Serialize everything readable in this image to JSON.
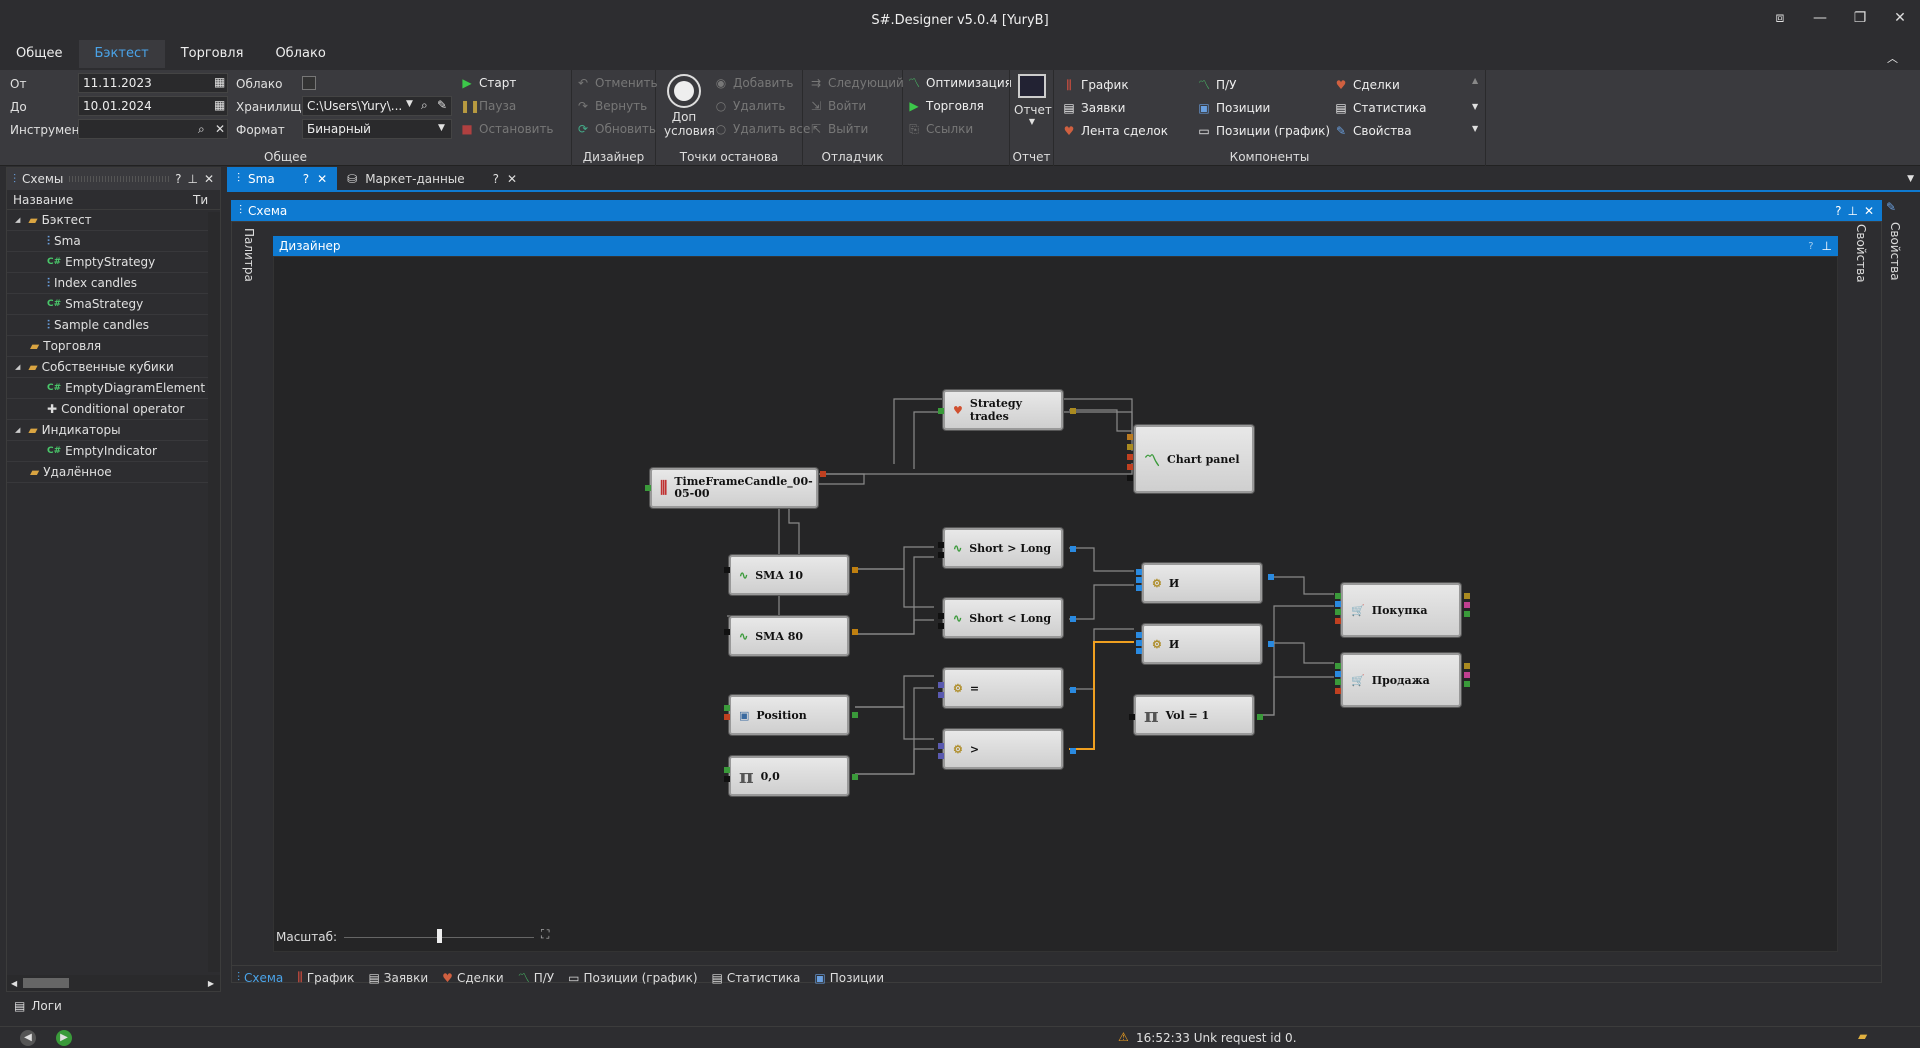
{
  "window": {
    "title": "S#.Designer v5.0.4 [YuryB]"
  },
  "ribbon_tabs": [
    "Общее",
    "Бэктест",
    "Торговля",
    "Облако"
  ],
  "general": {
    "from_label": "От",
    "from_value": "11.11.2023",
    "to_label": "До",
    "to_value": "10.01.2024",
    "instrument_label": "Инструмент",
    "cloud_label": "Облако",
    "storage_label": "Хранилище",
    "storage_value": "C:\\Users\\Yury\\...",
    "format_label": "Формат",
    "format_value": "Бинарный",
    "start": "Старт",
    "pause": "Пауза",
    "stop": "Остановить",
    "group": "Общее"
  },
  "designer": {
    "undo": "Отменить",
    "redo": "Вернуть",
    "refresh": "Обновить",
    "group": "Дизайнер"
  },
  "breakpoints": {
    "extra_line1": "Доп",
    "extra_line2": "условия",
    "add": "Добавить",
    "remove": "Удалить",
    "remove_all": "Удалить все",
    "group": "Точки останова"
  },
  "debugger": {
    "next": "Следующий",
    "enter": "Войти",
    "exit": "Выйти",
    "group": "Отладчик"
  },
  "links": {
    "optimization": "Оптимизация",
    "trading": "Торговля",
    "links": "Ссылки"
  },
  "report": {
    "label": "Отчет",
    "group": "Отчет"
  },
  "components": {
    "col1": [
      "График",
      "Заявки",
      "Лента сделок"
    ],
    "col2": [
      "П/У",
      "Позиции",
      "Позиции (график)"
    ],
    "col3": [
      "Сделки",
      "Статистика",
      "Свойства"
    ],
    "group": "Компоненты"
  },
  "sidebar": {
    "title": "Схемы",
    "col_name": "Название",
    "col_type": "Ти",
    "tree": [
      {
        "label": "Бэктест",
        "level": 0,
        "kind": "folder"
      },
      {
        "label": "Sma",
        "level": 1,
        "kind": "schema"
      },
      {
        "label": "EmptyStrategy",
        "level": 1,
        "kind": "code"
      },
      {
        "label": "Index candles",
        "level": 1,
        "kind": "schema"
      },
      {
        "label": "SmaStrategy",
        "level": 1,
        "kind": "code"
      },
      {
        "label": "Sample candles",
        "level": 1,
        "kind": "schema"
      },
      {
        "label": "Торговля",
        "level": 0,
        "kind": "folder"
      },
      {
        "label": "Собственные кубики",
        "level": 0,
        "kind": "folder"
      },
      {
        "label": "EmptyDiagramElement",
        "level": 1,
        "kind": "code"
      },
      {
        "label": "Conditional operator",
        "level": 1,
        "kind": "puzzle"
      },
      {
        "label": "Индикаторы",
        "level": 0,
        "kind": "folder"
      },
      {
        "label": "EmptyIndicator",
        "level": 1,
        "kind": "code"
      },
      {
        "label": "Удалённое",
        "level": 0,
        "kind": "folder"
      }
    ]
  },
  "doc_tabs": [
    "Sma",
    "Маркет-данные"
  ],
  "schema_panel": {
    "title": "Схема",
    "palette": "Палитра",
    "properties": "Свойства",
    "designer_title": "Дизайнер",
    "scale_label": "Масштаб:",
    "scale_value": 0.5
  },
  "nodes": {
    "strategy_trades": "Strategy trades",
    "chart_panel": "Chart panel",
    "candles": "TimeFrameCandle_00-05-00",
    "sma10": "SMA 10",
    "sma80": "SMA 80",
    "short_gt_long": "Short > Long",
    "short_lt_long": "Short < Long",
    "and1": "И",
    "and2": "И",
    "buy": "Покупка",
    "sell": "Продажа",
    "eq": "=",
    "gt": ">",
    "position": "Position",
    "zero": "0,0",
    "vol": "Vol = 1"
  },
  "bottom_tabs": [
    "Схема",
    "График",
    "Заявки",
    "Сделки",
    "П/У",
    "Позиции (график)",
    "Статистика",
    "Позиции"
  ],
  "logs": {
    "label": "Логи"
  },
  "status": {
    "message": "16:52:33  Unk request id 0."
  },
  "colors": {
    "accent": "#0e7ad1",
    "bg": "#2d2d30",
    "node": "#dcdcdc",
    "wire_active": "#f0a020"
  }
}
